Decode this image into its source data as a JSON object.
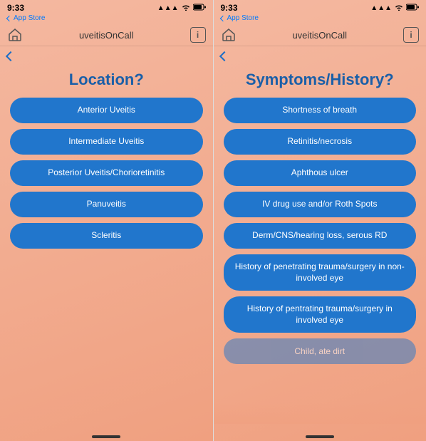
{
  "left_screen": {
    "status": {
      "time": "9:33",
      "signal": "●●●",
      "wifi": "wifi",
      "battery": "🔋"
    },
    "app_store_label": "App Store",
    "nav_title": "uveitisOnCall",
    "page_title": "Location?",
    "back_label": "",
    "buttons": [
      "Anterior Uveitis",
      "Intermediate Uveitis",
      "Posterior Uveitis/Chorioretinitis",
      "Panuveitis",
      "Scleritis"
    ]
  },
  "right_screen": {
    "status": {
      "time": "9:33",
      "signal": "●●●",
      "wifi": "wifi",
      "battery": "🔋"
    },
    "app_store_label": "App Store",
    "nav_title": "uveitisOnCall",
    "page_title": "Symptoms/History?",
    "back_label": "",
    "buttons": [
      "Shortness of breath",
      "Retinitis/necrosis",
      "Aphthous ulcer",
      "IV drug use and/or Roth Spots",
      "Derm/CNS/hearing loss, serous RD",
      "History of penetrating trauma/surgery\nin non-involved eye",
      "History of pentrating trauma/surgery\nin involved eye",
      "Child, ate dirt"
    ]
  }
}
